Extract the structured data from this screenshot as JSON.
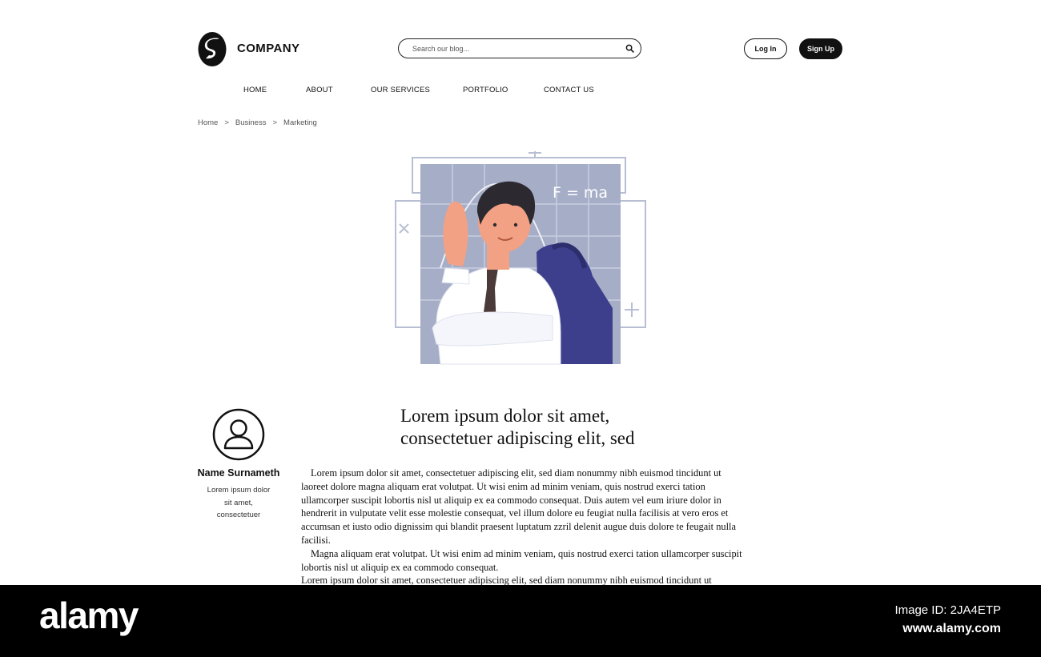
{
  "header": {
    "brand": "COMPANY",
    "search_placeholder": "Search our blog...",
    "login_label": "Log In",
    "signup_label": "Sign Up"
  },
  "nav": {
    "items": [
      {
        "label": "HOME"
      },
      {
        "label": "ABOUT"
      },
      {
        "label": "OUR SERVICES"
      },
      {
        "label": "PORTFOLIO"
      },
      {
        "label": "CONTACT US"
      }
    ]
  },
  "breadcrumb": {
    "items": [
      "Home",
      "Business",
      "Marketing"
    ],
    "separator": ">"
  },
  "hero": {
    "formula": "F = ma"
  },
  "author": {
    "name": "Name Surnameth",
    "bio_lines": [
      "Lorem ipsum dolor",
      "sit amet,",
      "consectetuer"
    ]
  },
  "post": {
    "title_line1": "Lorem ipsum dolor sit amet,",
    "title_line2": "consectetuer adipiscing elit, sed",
    "paragraph1": "Lorem ipsum dolor sit amet, consectetuer adipiscing elit, sed diam nonummy nibh euismod tincidunt ut laoreet dolore magna aliquam erat volutpat. Ut wisi enim ad minim veniam, quis nostrud exerci tation ullamcorper suscipit lobortis nisl ut aliquip ex ea commodo consequat. Duis autem vel eum iriure dolor in hendrerit in vulputate velit esse molestie consequat, vel illum dolore eu feugiat nulla facilisis at vero eros et accumsan et iusto odio dignissim qui blandit praesent luptatum zzril delenit augue duis dolore te feugait nulla facilisi.",
    "paragraph2": "Magna aliquam erat volutpat. Ut wisi enim ad minim veniam, quis nostrud exerci tation ullamcorper suscipit lobortis nisl ut aliquip ex ea commodo consequat.",
    "paragraph3": "Lorem ipsum dolor sit amet, consectetuer adipiscing elit, sed diam nonummy nibh euismod tincidunt ut"
  },
  "watermark": {
    "logo_text": "alamy",
    "image_id": "Image ID: 2JA4ETP",
    "site": "www.alamy.com"
  },
  "colors": {
    "hero_bg": "#a5adc7",
    "backpack": "#3d3f8c",
    "skin": "#f2a184",
    "hair": "#2c2a30"
  }
}
